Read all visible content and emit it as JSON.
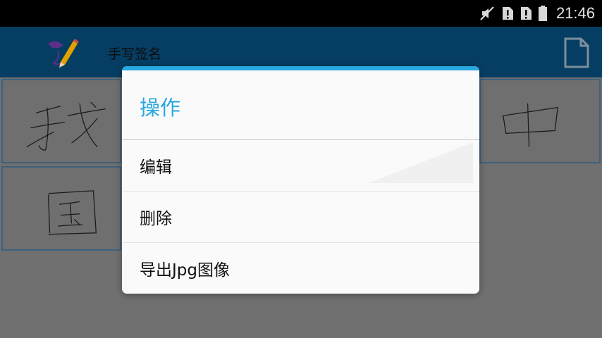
{
  "status_bar": {
    "time": "21:46",
    "icons": [
      "muted-icon",
      "alert-sim-icon",
      "alert-sim-icon",
      "battery-icon"
    ]
  },
  "app_bar": {
    "title": "手写签名",
    "logo_icon": "signature-pen-icon",
    "action_icon": "new-file-icon"
  },
  "signatures": [
    "我",
    "中",
    "国"
  ],
  "dialog": {
    "title": "操作",
    "accent_color": "#29a8e0",
    "items": [
      {
        "label": "编辑"
      },
      {
        "label": "删除"
      },
      {
        "label": "导出Jpg图像"
      }
    ]
  }
}
